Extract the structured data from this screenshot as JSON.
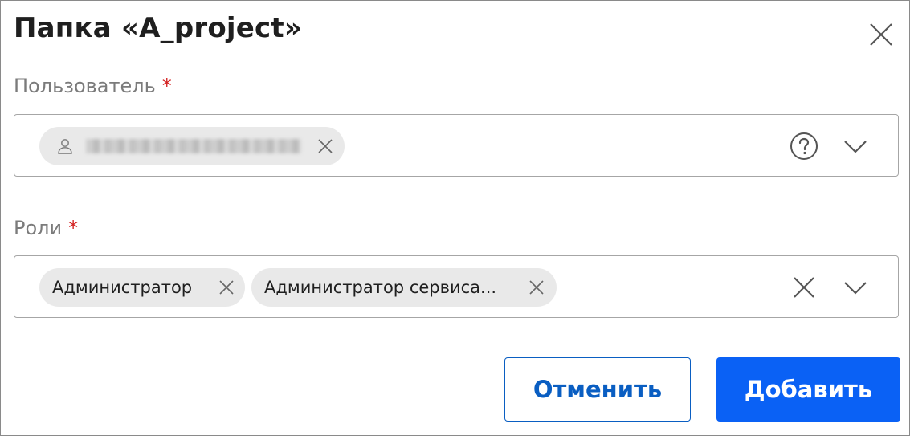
{
  "dialog": {
    "title": "Папка «A_project»",
    "close_icon": "close-icon"
  },
  "user_field": {
    "label": "Пользователь",
    "required_mark": "*",
    "selected_chip_icon": "user-icon",
    "chip_remove_icon": "close-icon",
    "help_icon": "question-circle-icon",
    "dropdown_icon": "chevron-down-icon"
  },
  "roles_field": {
    "label": "Роли",
    "required_mark": "*",
    "chips": [
      {
        "label": "Администратор"
      },
      {
        "label": "Администратор сервиса..."
      }
    ],
    "clear_icon": "close-icon",
    "dropdown_icon": "chevron-down-icon"
  },
  "actions": {
    "cancel_label": "Отменить",
    "add_label": "Добавить"
  },
  "colors": {
    "primary": "#0a61f5",
    "required": "#d32020",
    "chip_bg": "#e9e9e9"
  }
}
